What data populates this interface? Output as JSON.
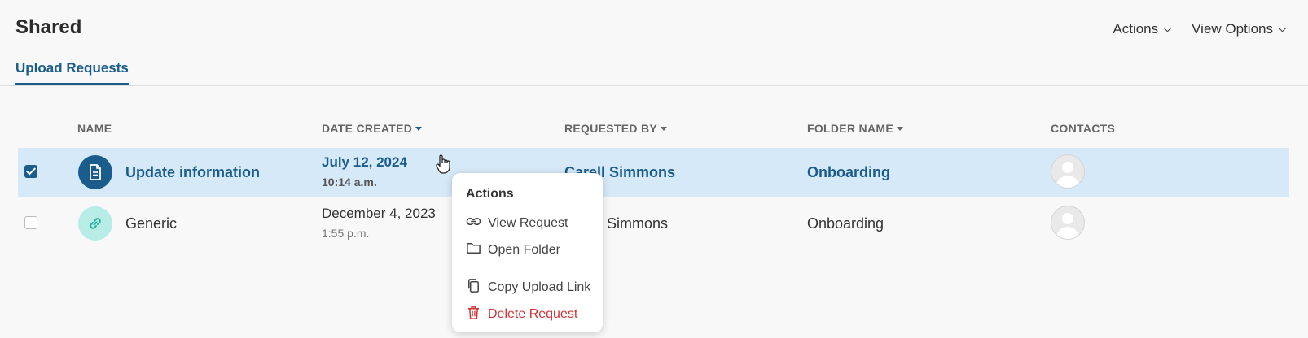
{
  "header": {
    "title": "Shared",
    "actions_label": "Actions",
    "view_options_label": "View Options"
  },
  "tabs": [
    {
      "label": "Upload Requests",
      "active": true
    }
  ],
  "table": {
    "columns": {
      "name": "NAME",
      "date_created": "DATE CREATED",
      "requested_by": "REQUESTED BY",
      "folder_name": "FOLDER NAME",
      "contacts": "CONTACTS"
    },
    "rows": [
      {
        "selected": true,
        "type_icon": "document-icon",
        "name": "Update information",
        "date": "July 12, 2024",
        "time": "10:14 a.m.",
        "requested_by": "Carell Simmons",
        "folder": "Onboarding",
        "contact_avatar": "avatar-placeholder"
      },
      {
        "selected": false,
        "type_icon": "link-icon",
        "name": "Generic",
        "date": "December 4, 2023",
        "time": "1:55 p.m.",
        "requested_by": "Carell Simmons",
        "folder": "Onboarding",
        "contact_avatar": "avatar-placeholder"
      }
    ]
  },
  "context_menu": {
    "title": "Actions",
    "items": [
      {
        "label": "View Request",
        "icon": "link-icon"
      },
      {
        "label": "Open Folder",
        "icon": "folder-icon"
      },
      {
        "label": "Copy Upload Link",
        "icon": "copy-icon"
      },
      {
        "label": "Delete Request",
        "icon": "trash-icon",
        "color": "#d43333"
      }
    ]
  },
  "colors": {
    "accent": "#1a5d8c",
    "selected_row": "#d6e9f9",
    "danger": "#d43333",
    "link_icon_bg": "#b8ece6"
  }
}
